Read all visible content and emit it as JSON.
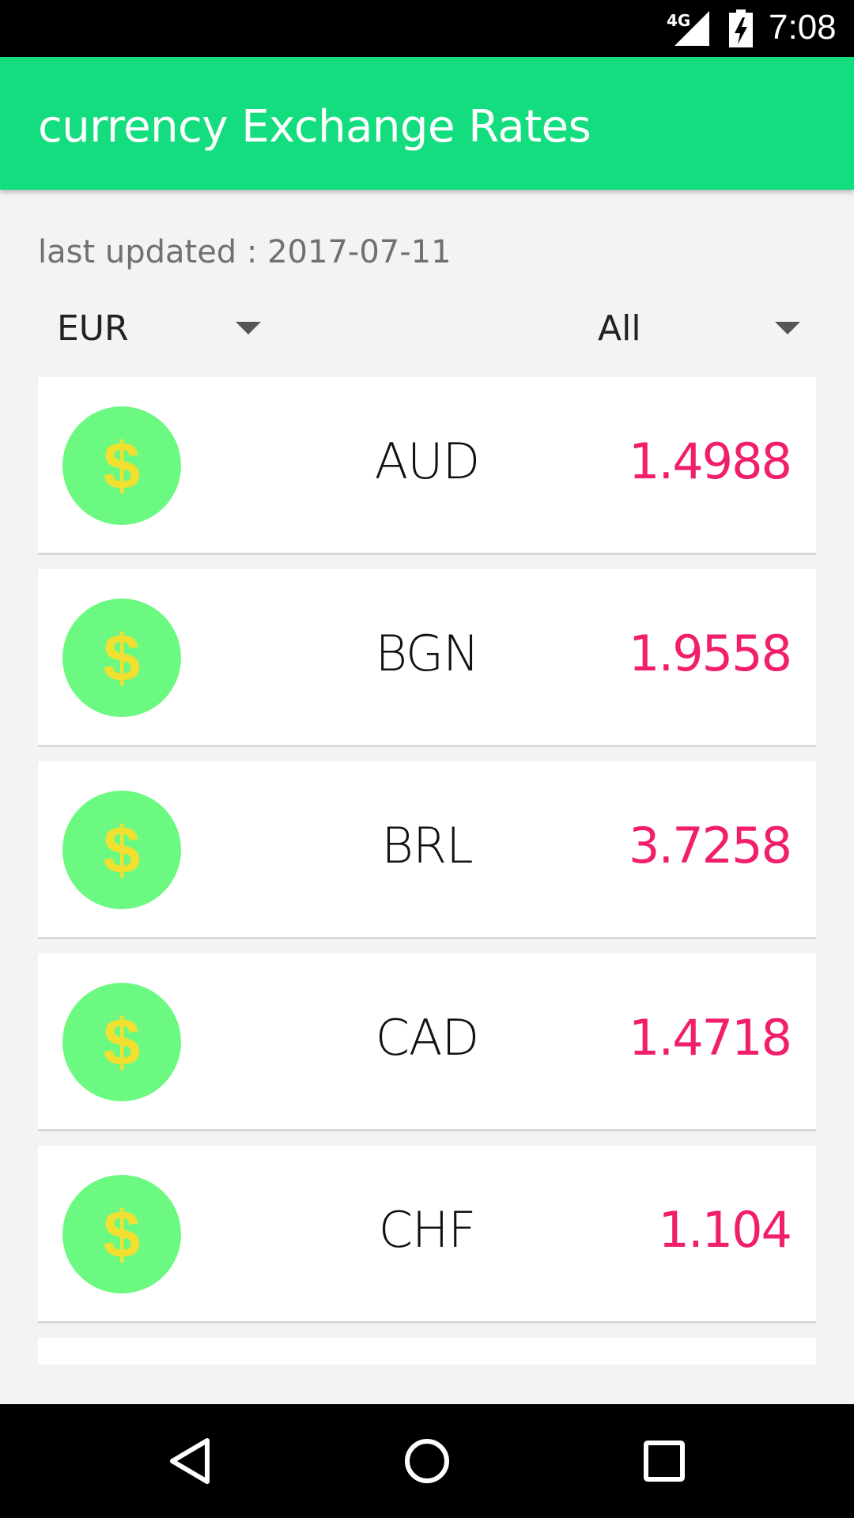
{
  "status": {
    "network": "4G",
    "time": "7:08"
  },
  "app": {
    "title": "currency Exchange Rates"
  },
  "last_updated": "last updated : 2017-07-11",
  "spinners": {
    "base_currency": "EUR",
    "filter": "All"
  },
  "rates": [
    {
      "code": "AUD",
      "rate": "1.4988"
    },
    {
      "code": "BGN",
      "rate": "1.9558"
    },
    {
      "code": "BRL",
      "rate": "3.7258"
    },
    {
      "code": "CAD",
      "rate": "1.4718"
    },
    {
      "code": "CHF",
      "rate": "1.104"
    }
  ],
  "icon_symbol": "$",
  "colors": {
    "app_bar": "#13dd7f",
    "rate_text": "#f01e6b",
    "coin": "#6bf981",
    "coin_symbol": "#f2e031"
  },
  "icons": {
    "row": "dollar-coin-icon",
    "spinner": "dropdown-arrow-icon",
    "nav": [
      "back-icon",
      "home-icon",
      "recents-icon"
    ]
  }
}
